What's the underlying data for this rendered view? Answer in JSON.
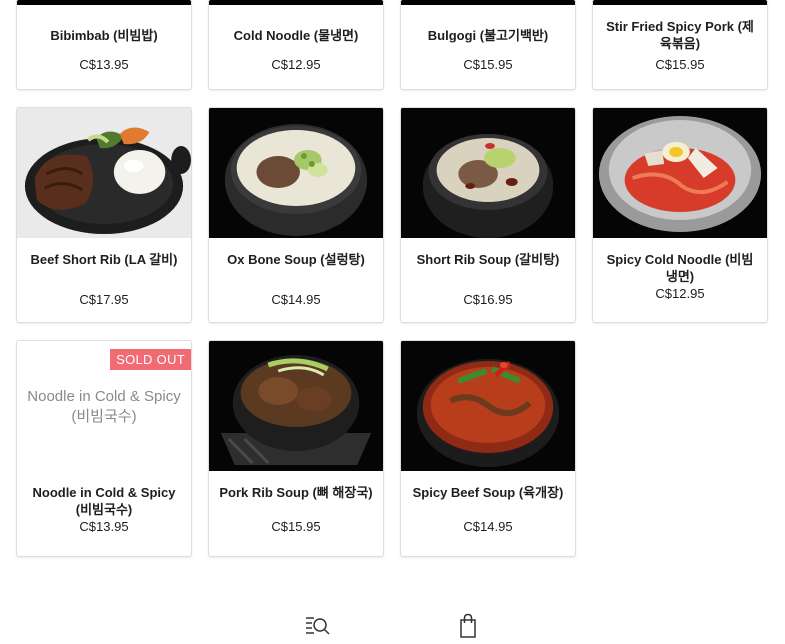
{
  "menu": {
    "row0": [
      {
        "name": "Bibimbab (비빔밥)",
        "price": "C$13.95"
      },
      {
        "name": "Cold Noodle (물냉면)",
        "price": "C$12.95"
      },
      {
        "name": "Bulgogi (불고기백반)",
        "price": "C$15.95"
      },
      {
        "name": "Stir Fried Spicy Pork (제육볶음)",
        "price": "C$15.95"
      }
    ],
    "row1": [
      {
        "name": "Beef Short Rib (LA 갈비)",
        "price": "C$17.95"
      },
      {
        "name": "Ox Bone Soup (설렁탕)",
        "price": "C$14.95"
      },
      {
        "name": "Short Rib Soup (갈비탕)",
        "price": "C$16.95"
      },
      {
        "name": "Spicy Cold Noodle (비빔냉면)",
        "price": "C$12.95"
      }
    ],
    "row2": [
      {
        "name": "Noodle in Cold & Spicy (비빔국수)",
        "price": "C$13.95",
        "badge": "SOLD OUT",
        "placeholder": "Noodle in Cold & Spicy (비빔국수)"
      },
      {
        "name": "Pork Rib Soup (뼈 해장국)",
        "price": "C$15.95"
      },
      {
        "name": "Spicy Beef Soup (육개장)",
        "price": "C$14.95"
      }
    ]
  },
  "nav": {
    "menu_icon": "menu-search-icon",
    "cart_icon": "shopping-bag-icon"
  },
  "colors": {
    "sold_out_badge": "#f06b72",
    "card_border": "#dedede"
  }
}
